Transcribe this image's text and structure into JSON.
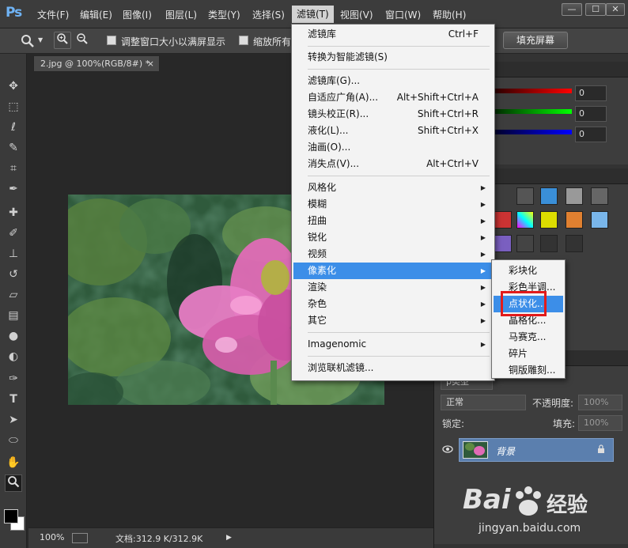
{
  "app": {
    "logo": "Ps"
  },
  "menubar": {
    "items": [
      "文件(F)",
      "编辑(E)",
      "图像(I)",
      "图层(L)",
      "类型(Y)",
      "选择(S)",
      "滤镜(T)",
      "视图(V)",
      "窗口(W)",
      "帮助(H)"
    ],
    "active": "滤镜(T)"
  },
  "window_buttons": {
    "minimize": "—",
    "maximize": "☐",
    "close": "✕"
  },
  "options": {
    "resize_windows": "调整窗口大小以满屏显示",
    "zoom_all": "缩放所有",
    "fill_screen": "填充屏幕"
  },
  "document": {
    "tab_title": "2.jpg @ 100%(RGB/8#) *",
    "close": "×",
    "zoom": "100%",
    "file_info": "文档:312.9 K/312.9K",
    "arrow": "▶"
  },
  "filter_menu": {
    "items": [
      {
        "label": "滤镜库",
        "shortcut": "Ctrl+F"
      },
      {
        "label": "转换为智能滤镜(S)",
        "shortcut": ""
      },
      {
        "label": "滤镜库(G)...",
        "shortcut": ""
      },
      {
        "label": "自适应广角(A)...",
        "shortcut": "Alt+Shift+Ctrl+A"
      },
      {
        "label": "镜头校正(R)...",
        "shortcut": "Shift+Ctrl+R"
      },
      {
        "label": "液化(L)...",
        "shortcut": "Shift+Ctrl+X"
      },
      {
        "label": "油画(O)...",
        "shortcut": ""
      },
      {
        "label": "消失点(V)...",
        "shortcut": "Alt+Ctrl+V"
      },
      {
        "label": "风格化",
        "submenu": true
      },
      {
        "label": "模糊",
        "submenu": true
      },
      {
        "label": "扭曲",
        "submenu": true
      },
      {
        "label": "锐化",
        "submenu": true
      },
      {
        "label": "视频",
        "submenu": true
      },
      {
        "label": "像素化",
        "submenu": true,
        "highlighted": true
      },
      {
        "label": "渲染",
        "submenu": true
      },
      {
        "label": "杂色",
        "submenu": true
      },
      {
        "label": "其它",
        "submenu": true
      },
      {
        "label": "Imagenomic",
        "submenu": true
      },
      {
        "label": "浏览联机滤镜...",
        "shortcut": ""
      }
    ],
    "arrow_glyph": "▶"
  },
  "pixelate_submenu": {
    "items": [
      "彩块化",
      "彩色半调...",
      "点状化...",
      "晶格化...",
      "马赛克...",
      "碎片",
      "铜版雕刻..."
    ],
    "highlighted": "点状化..."
  },
  "color_panel": {
    "values": [
      "0",
      "0",
      "0"
    ]
  },
  "layers_panel": {
    "filter_kind": "ρ类型",
    "blend_mode": "正常",
    "opacity_label": "不透明度:",
    "opacity_value": "100%",
    "lock_label": "锁定:",
    "fill_label": "填充:",
    "fill_value": "100%",
    "layer_name": "背景",
    "eye": "👁",
    "lock_icon": "🔒"
  },
  "watermark": {
    "brand": "Bai",
    "brand2": "经验",
    "url": "jingyan.baidu.com"
  },
  "colors": {
    "menu_highlight": "#3c8ee8",
    "annotation_box": "#e21b1b",
    "layer_selected": "#5b7fae"
  }
}
